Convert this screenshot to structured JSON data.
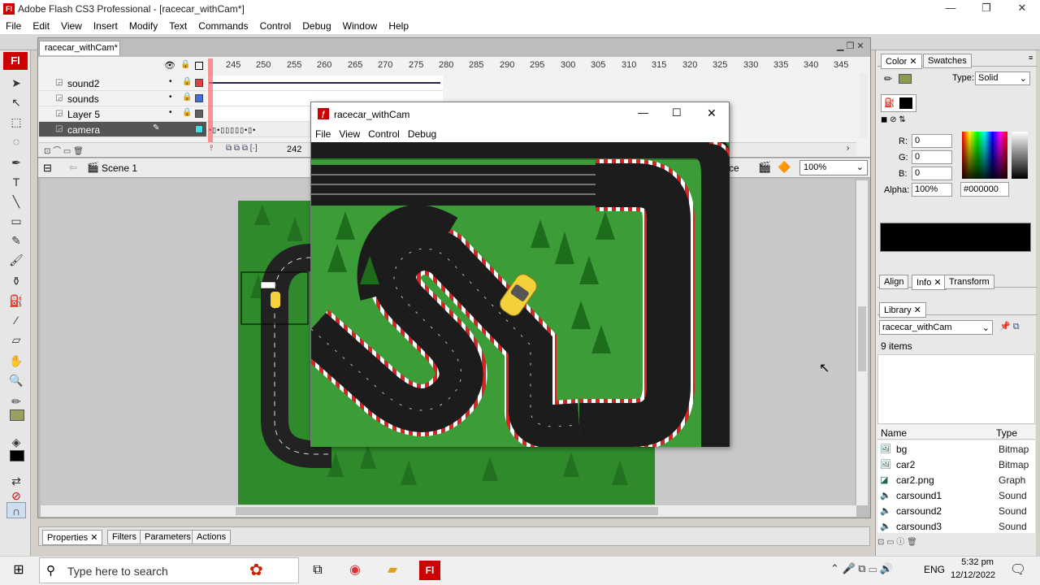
{
  "window": {
    "title": "Adobe Flash CS3 Professional - [racecar_withCam*]",
    "logo_text": "Fl"
  },
  "menu": [
    "File",
    "Edit",
    "View",
    "Insert",
    "Modify",
    "Text",
    "Commands",
    "Control",
    "Debug",
    "Window",
    "Help"
  ],
  "document": {
    "tab": "racecar_withCam*",
    "scene": "Scene 1",
    "zoom": "100%",
    "scene_partial": "ce",
    "frame_number": "242"
  },
  "timeline": {
    "ruler": [
      "245",
      "250",
      "255",
      "260",
      "265",
      "270",
      "275",
      "280",
      "285",
      "290",
      "295",
      "300",
      "305",
      "310",
      "315",
      "320",
      "325",
      "330",
      "335",
      "340",
      "345"
    ],
    "layers": [
      {
        "name": "sound2",
        "color": "#e04040"
      },
      {
        "name": "sounds",
        "color": "#4070e0"
      },
      {
        "name": "Layer 5",
        "color": "#606060"
      },
      {
        "name": "camera",
        "color": "#40e0e0",
        "selected": true
      }
    ]
  },
  "player": {
    "title": "racecar_withCam",
    "menu": [
      "File",
      "View",
      "Control",
      "Debug"
    ]
  },
  "color_panel": {
    "tabs": [
      "Color",
      "Swatches"
    ],
    "type_label": "Type:",
    "type_value": "Solid",
    "r_label": "R:",
    "r": "0",
    "g_label": "G:",
    "g": "0",
    "b_label": "B:",
    "b": "0",
    "alpha_label": "Alpha:",
    "alpha": "100%",
    "hex": "#000000"
  },
  "align_tabs": [
    "Align",
    "Info",
    "Transform"
  ],
  "library": {
    "tab": "Library",
    "document": "racecar_withCam",
    "count": "9 items",
    "col_name": "Name",
    "col_type": "Type",
    "items": [
      {
        "name": "bg",
        "type": "Bitmap"
      },
      {
        "name": "car2",
        "type": "Bitmap"
      },
      {
        "name": "car2.png",
        "type": "Graph"
      },
      {
        "name": "carsound1",
        "type": "Sound"
      },
      {
        "name": "carsound2",
        "type": "Sound"
      },
      {
        "name": "carsound3",
        "type": "Sound"
      }
    ]
  },
  "properties_tabs": [
    "Properties",
    "Filters",
    "Parameters",
    "Actions"
  ],
  "taskbar": {
    "search_placeholder": "Type here to search",
    "lang": "ENG",
    "time": "5:32 pm",
    "date": "12/12/2022"
  }
}
